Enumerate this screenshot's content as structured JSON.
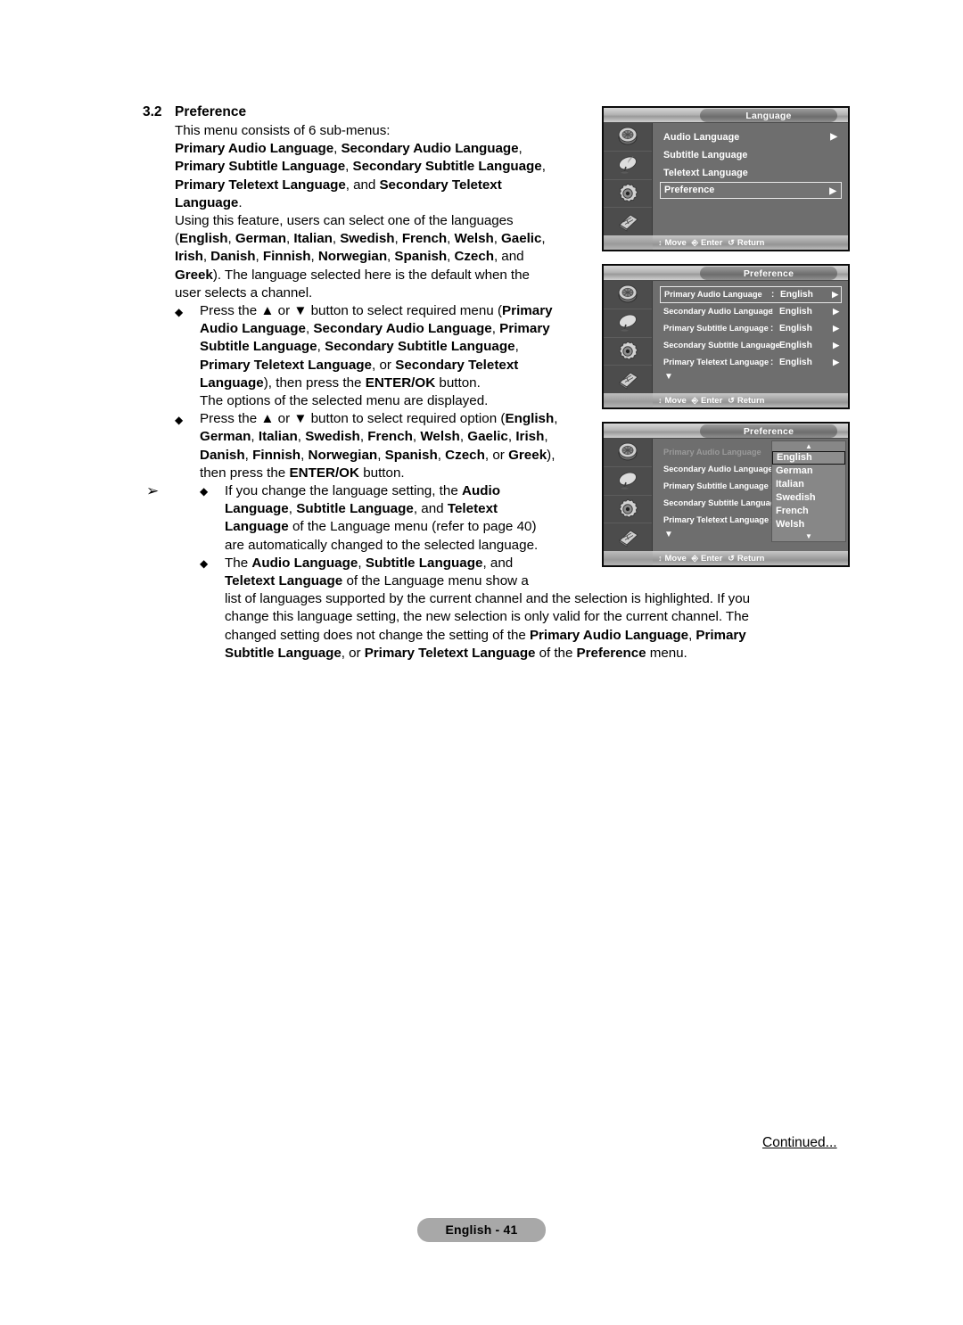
{
  "section": {
    "number": "3.2",
    "title": "Preference"
  },
  "body": {
    "intro": "This menu consists of 6 sub-menus:",
    "submenu_list_line1_a": "Primary Audio Language",
    "submenu_list_line1_sep": ", ",
    "submenu_list_line1_b": "Secondary Audio Language",
    "submenu_list_line1_end": ",",
    "submenu_list_line2_a": "Primary Subtitle Language",
    "submenu_list_line2_b": "Secondary Subtitle Language",
    "submenu_list_line2_end": ",",
    "submenu_list_line3_a": "Primary Teletext Language",
    "submenu_list_line3_mid": ", and ",
    "submenu_list_line3_b": "Secondary Teletext",
    "submenu_list_line4": "Language",
    "submenu_list_line4_end": ".",
    "feature_line1": "Using this feature, users can select one of the languages",
    "feature_open": "(",
    "lang_english": "English",
    "lang_german": "German",
    "lang_italian": "Italian",
    "lang_swedish": "Swedish",
    "lang_french": "French",
    "lang_welsh": "Welsh",
    "lang_gaelic": "Gaelic",
    "lang_irish": "Irish",
    "lang_danish": "Danish",
    "lang_finnish": "Finnish",
    "lang_norwegian": "Norwegian",
    "lang_spanish": "Spanish",
    "lang_czech": "Czech",
    "lang_greek": "Greek",
    "feature_tail_1": ", and",
    "feature_tail_2": "). The language selected here is the default when the",
    "feature_tail_3": "user selects a channel.",
    "bullet1_p1": "Press the ▲ or ▼ button to select required menu (",
    "bullet1_b1": "Primary",
    "bullet1_b2": "Audio Language",
    "bullet1_b3": "Secondary Audio Language",
    "bullet1_b4": "Primary",
    "bullet1_b5": "Subtitle Language",
    "bullet1_b6": "Secondary Subtitle Language",
    "bullet1_b7": "Primary Teletext Language",
    "bullet1_or": ", or ",
    "bullet1_b8": "Secondary Teletext",
    "bullet1_b9": "Language",
    "bullet1_then": "), then press the ",
    "bullet1_enter": "ENTER/OK",
    "bullet1_btn": " button.",
    "bullet1_sub": "The options of the selected menu are displayed.",
    "bullet2_p1": "Press the ▲ or ▼ button to select required option (",
    "bullet2_or": ", or ",
    "bullet2_tail": "),",
    "bullet2_then": "then press the ",
    "note_arrow": "➢",
    "note1_a": "If you change the language setting, the ",
    "note1_b1": "Audio",
    "note1_b2": "Language",
    "note1_b3": "Subtitle Language",
    "note1_and": ", and ",
    "note1_b4": "Teletext",
    "note1_b5": "Language",
    "note1_c": " of the Language menu (refer to page 40)",
    "note1_d": "are automatically changed to the selected language.",
    "note2_the": "The ",
    "note2_b1": "Audio Language",
    "note2_b2": "Subtitle Language",
    "note2_and": ", and",
    "note2_b3": "Teletext Language",
    "note2_c": " of the Language menu show a",
    "note2_d": "list of languages supported by the current channel and the selection is highlighted. If you",
    "note2_e": "change this language setting, the new selection is only valid for the current channel. The",
    "note2_f": "changed setting does not change the setting of the ",
    "note2_b4": "Primary Audio Language",
    "note2_b5": "Primary",
    "note2_b6": "Subtitle Language",
    "note2_or": ", or ",
    "note2_b7": "Primary Teletext Language",
    "note2_g": " of the ",
    "note2_b8": "Preference",
    "note2_h": " menu."
  },
  "osd_common": {
    "footer": {
      "move": "Move",
      "enter": "Enter",
      "return": "Return"
    },
    "side_icons": [
      "picture-icon",
      "satellite-dish-icon",
      "setup-gear-icon",
      "remote-control-icon"
    ],
    "arrow_right": "▶",
    "caret_down": "▼",
    "caret_up": "▲",
    "move_glyph": "↕",
    "return_glyph": "↺"
  },
  "osd_panels": [
    {
      "id": "language-menu",
      "title": "Language",
      "rows": [
        {
          "label": "Audio Language",
          "arrow": true,
          "selected": false
        },
        {
          "label": "Subtitle Language",
          "arrow": false,
          "selected": false
        },
        {
          "label": "Teletext Language",
          "arrow": false,
          "selected": false
        },
        {
          "label": "Preference",
          "arrow": true,
          "selected": true
        }
      ]
    },
    {
      "id": "preference-menu",
      "title": "Preference",
      "rows": [
        {
          "label": "Primary Audio Language",
          "colon": ":",
          "value": "English",
          "arrow": true,
          "selected": true,
          "dim": false
        },
        {
          "label": "Secondary Audio Language",
          "colon": ":",
          "value": "English",
          "arrow": true,
          "selected": false,
          "dim": false
        },
        {
          "label": "Primary Subtitle Language",
          "colon": ":",
          "value": "English",
          "arrow": true,
          "selected": false,
          "dim": false
        },
        {
          "label": "Secondary Subtitle Language",
          "colon": ":",
          "value": "English",
          "arrow": true,
          "selected": false,
          "dim": false
        },
        {
          "label": "Primary Teletext Language",
          "colon": ":",
          "value": "English",
          "arrow": true,
          "selected": false,
          "dim": false
        }
      ],
      "more_caret": "▼"
    },
    {
      "id": "preference-menu-dropdown",
      "title": "Preference",
      "rows": [
        {
          "label": "Primary Audio Language",
          "colon": ":",
          "value": "",
          "arrow": false,
          "selected": false,
          "dim": true
        },
        {
          "label": "Secondary Audio Language",
          "colon": ":",
          "value": "",
          "arrow": false,
          "selected": false,
          "dim": false
        },
        {
          "label": "Primary Subtitle Language",
          "colon": ":",
          "value": "",
          "arrow": false,
          "selected": false,
          "dim": false
        },
        {
          "label": "Secondary Subtitle Language",
          "colon": ":",
          "value": "",
          "arrow": false,
          "selected": false,
          "dim": false
        },
        {
          "label": "Primary Teletext Language",
          "colon": ":",
          "value": "",
          "arrow": false,
          "selected": false,
          "dim": false
        }
      ],
      "more_caret": "▼",
      "dropdown": {
        "scroll_up": "▲",
        "scroll_down": "▼",
        "options": [
          {
            "label": "English",
            "selected": true
          },
          {
            "label": "German",
            "selected": false
          },
          {
            "label": "Italian",
            "selected": false
          },
          {
            "label": "Swedish",
            "selected": false
          },
          {
            "label": "French",
            "selected": false
          },
          {
            "label": "Welsh",
            "selected": false
          }
        ]
      }
    }
  ],
  "footer": {
    "continued": "Continued...",
    "page_badge": "English - 41"
  }
}
